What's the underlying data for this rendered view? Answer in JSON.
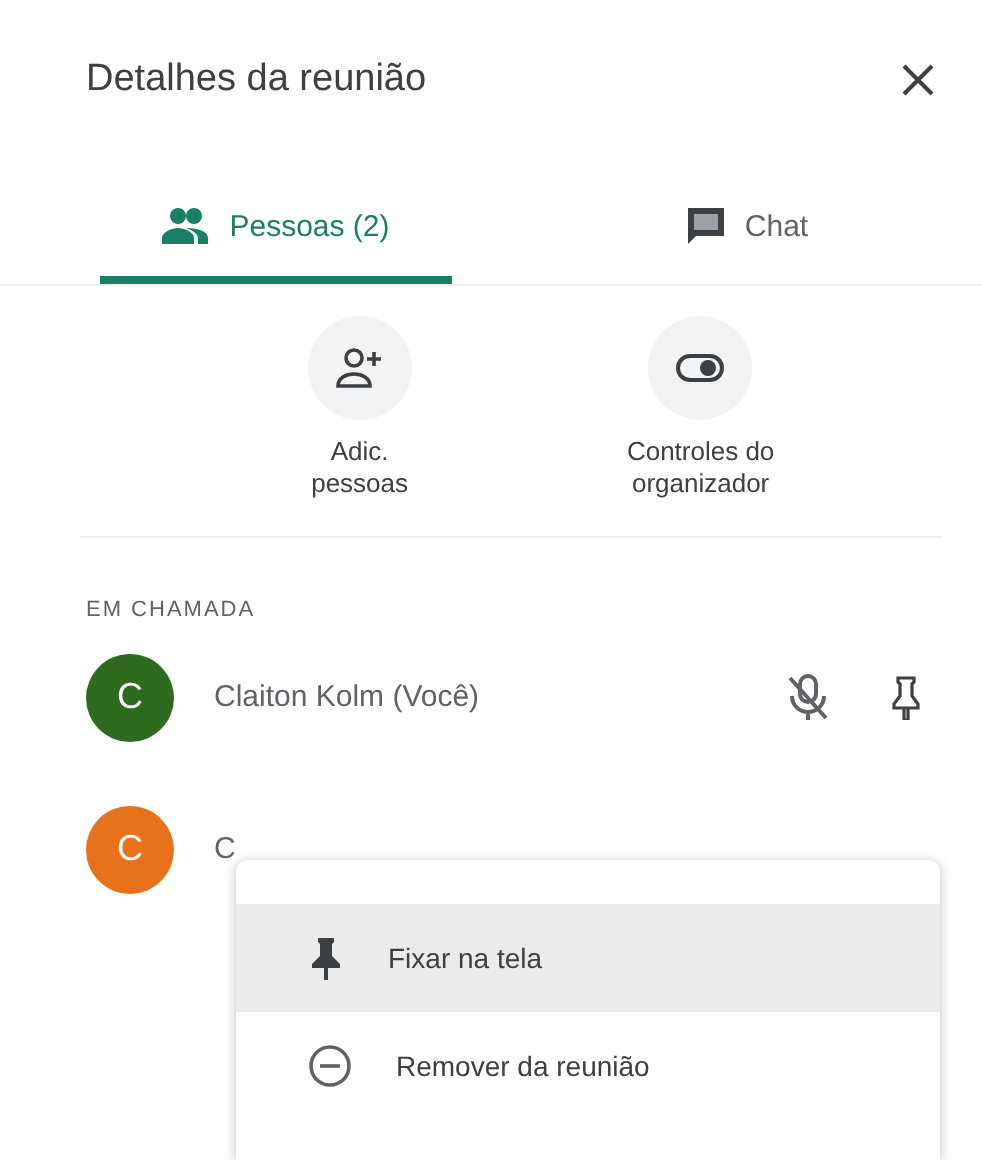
{
  "panel": {
    "title": "Detalhes da reunião"
  },
  "tabs": [
    {
      "kind": "people",
      "label": "Pessoas (2)",
      "selected": true
    },
    {
      "kind": "chat",
      "label": "Chat",
      "selected": false
    }
  ],
  "actions": [
    {
      "kind": "add-person",
      "label": "Adic.\npessoas"
    },
    {
      "kind": "toggle",
      "label": "Controles do\norganizador"
    }
  ],
  "section": {
    "heading": "EM CHAMADA"
  },
  "participants": [
    {
      "initial": "C",
      "name": "Claiton Kolm (Você)",
      "color": "#2e6b1f",
      "muted": true,
      "pin_button": true
    },
    {
      "initial": "C",
      "name": "C",
      "color": "#e8711c",
      "muted": false,
      "pin_button": false
    }
  ],
  "menu": {
    "items": [
      {
        "kind": "pin",
        "label": "Fixar na tela",
        "selected": true
      },
      {
        "kind": "remove",
        "label": "Remover da reunião",
        "selected": false
      }
    ]
  }
}
